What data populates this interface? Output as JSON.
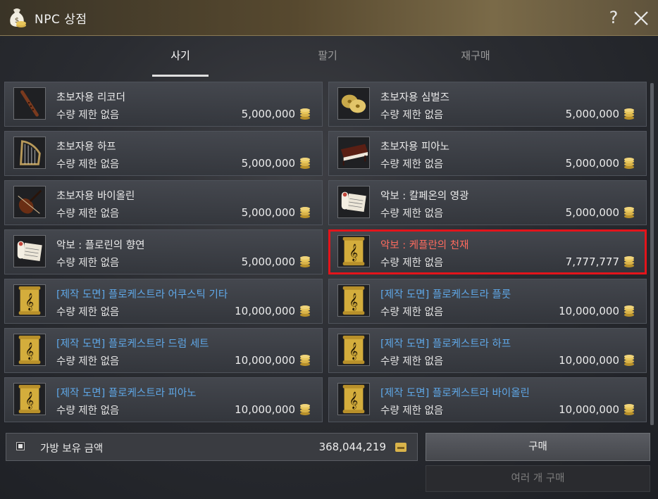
{
  "window": {
    "title": "NPC 상점",
    "help_label": "?",
    "title_icon": "money-bag-icon",
    "close_icon": "close-icon"
  },
  "tabs": [
    {
      "label": "사기",
      "active": true
    },
    {
      "label": "팔기",
      "active": false
    },
    {
      "label": "재구매",
      "active": false
    }
  ],
  "items": [
    {
      "name": "초보자용 리코더",
      "limit": "수량 제한 없음",
      "price": "5,000,000",
      "icon": "recorder-icon",
      "style": "normal"
    },
    {
      "name": "초보자용 심벌즈",
      "limit": "수량 제한 없음",
      "price": "5,000,000",
      "icon": "cymbals-icon",
      "style": "normal"
    },
    {
      "name": "초보자용 하프",
      "limit": "수량 제한 없음",
      "price": "5,000,000",
      "icon": "harp-icon",
      "style": "normal"
    },
    {
      "name": "초보자용 피아노",
      "limit": "수량 제한 없음",
      "price": "5,000,000",
      "icon": "piano-icon",
      "style": "normal"
    },
    {
      "name": "초보자용 바이올린",
      "limit": "수량 제한 없음",
      "price": "5,000,000",
      "icon": "violin-icon",
      "style": "normal"
    },
    {
      "name": "악보 : 칼페온의 영광",
      "limit": "수량 제한 없음",
      "price": "5,000,000",
      "icon": "sheet-music-icon",
      "style": "normal"
    },
    {
      "name": "악보 : 플로린의 향연",
      "limit": "수량 제한 없음",
      "price": "5,000,000",
      "icon": "sheet-music-icon",
      "style": "normal"
    },
    {
      "name": "악보 : 케플란의 천재",
      "limit": "수량 제한 없음",
      "price": "7,777,777",
      "icon": "gold-scroll-icon",
      "style": "highlight"
    },
    {
      "name": "[제작 도면] 플로케스트라 어쿠스틱 기타",
      "limit": "수량 제한 없음",
      "price": "10,000,000",
      "icon": "gold-scroll-icon",
      "style": "blueprint"
    },
    {
      "name": "[제작 도면] 플로케스트라 플룻",
      "limit": "수량 제한 없음",
      "price": "10,000,000",
      "icon": "gold-scroll-icon",
      "style": "blueprint"
    },
    {
      "name": "[제작 도면] 플로케스트라 드럼 세트",
      "limit": "수량 제한 없음",
      "price": "10,000,000",
      "icon": "gold-scroll-icon",
      "style": "blueprint"
    },
    {
      "name": "[제작 도면] 플로케스트라 하프",
      "limit": "수량 제한 없음",
      "price": "10,000,000",
      "icon": "gold-scroll-icon",
      "style": "blueprint"
    },
    {
      "name": "[제작 도면] 플로케스트라 피아노",
      "limit": "수량 제한 없음",
      "price": "10,000,000",
      "icon": "gold-scroll-icon",
      "style": "blueprint"
    },
    {
      "name": "[제작 도면] 플로케스트라 바이올린",
      "limit": "수량 제한 없음",
      "price": "10,000,000",
      "icon": "gold-scroll-icon",
      "style": "blueprint"
    }
  ],
  "selected_item": 7,
  "footer": {
    "money_label": "가방 보유 금액",
    "money_value": "368,044,219",
    "buy_label": "구매",
    "multi_buy_label": "여러 개 구매"
  },
  "colors": {
    "selection_border": "#e3141b",
    "blueprint_text": "#5fa8e8",
    "highlight_text": "#ff6b5e",
    "coin": "#d9b34a"
  }
}
